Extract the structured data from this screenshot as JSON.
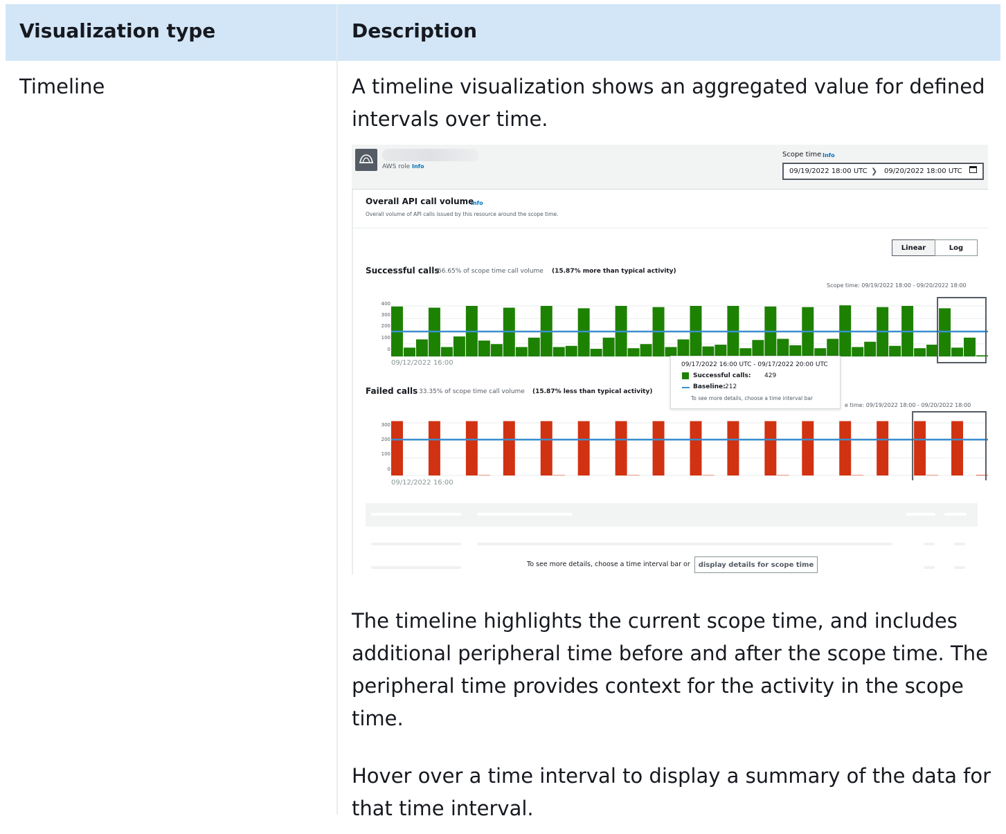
{
  "table": {
    "headers": [
      "Visualization type",
      "Description"
    ],
    "row": {
      "type": "Timeline",
      "description_intro": [
        "A timeline visualization shows an aggregated value for defined",
        "intervals over time."
      ],
      "description_p2": [
        "The timeline highlights the current scope time, and includes",
        "additional peripheral time before and after the scope time. The",
        "peripheral time provides context for the activity in the scope",
        "time."
      ],
      "description_p3": [
        "Hover over a time interval to display a summary of the data for",
        "that time interval."
      ]
    }
  },
  "screenshot": {
    "role_label": "AWS role",
    "info": "Info",
    "scope_time_label": "Scope time",
    "scope_start": "09/19/2022 18:00 UTC",
    "scope_end": "09/20/2022 18:00 UTC",
    "panel_title": "Overall API call volume",
    "panel_subtitle": "Overall volume of API calls issued by this resource around the scope time.",
    "scale_options": [
      "Linear",
      "Log"
    ],
    "scope_range": "Scope time: 09/19/2022 18:00 - 09/20/2022 18:00",
    "scope_range_partial": "e time: 09/19/2022 18:00 - 09/20/2022 18:00",
    "details_prompt": "To see more details, choose a time interval bar or",
    "details_button": "display details for scope time",
    "tooltip": {
      "range": "09/17/2022 16:00 UTC - 09/17/2022 20:00 UTC",
      "successful": "Successful calls:",
      "successful_value": "429",
      "baseline": "Baseline:",
      "baseline_value": "212",
      "hint": "To see more details, choose a time interval bar"
    },
    "colors": {
      "success": "#1d8102",
      "failed": "#d13212",
      "baseline": "#3b8fd0",
      "header": "#d3e6f8"
    }
  },
  "chart_data": [
    {
      "type": "bar",
      "title": "Successful calls",
      "subtitle": "66.65% of scope time call volume",
      "subtitle_emphasis": "(15.87% more than typical activity)",
      "x_start_label": "09/12/2022 16:00",
      "y_ticks": [
        "400",
        "300",
        "200",
        "100",
        "0"
      ],
      "ylim": [
        0,
        430
      ],
      "baseline": 212,
      "values": [
        425,
        75,
        145,
        415,
        80,
        170,
        430,
        135,
        105,
        415,
        80,
        160,
        430,
        80,
        90,
        410,
        65,
        160,
        430,
        70,
        105,
        420,
        80,
        145,
        430,
        85,
        100,
        430,
        70,
        140,
        425,
        150,
        95,
        420,
        70,
        150,
        435,
        80,
        125,
        420,
        90,
        430,
        70,
        100,
        410,
        75,
        160,
        10
      ],
      "scope_range_bars": [
        44,
        47
      ]
    },
    {
      "type": "bar",
      "title": "Failed calls",
      "subtitle": "33.35% of scope time call volume",
      "subtitle_emphasis": "(15.87% less than typical activity)",
      "x_start_label": "09/12/2022 16:00",
      "y_ticks": [
        "300",
        "200",
        "100",
        "0"
      ],
      "ylim": [
        0,
        300
      ],
      "baseline": 205,
      "values": [
        310,
        0,
        0,
        310,
        0,
        0,
        310,
        2,
        0,
        310,
        0,
        0,
        310,
        2,
        0,
        310,
        0,
        0,
        310,
        2,
        0,
        310,
        0,
        0,
        310,
        2,
        0,
        310,
        0,
        0,
        310,
        2,
        0,
        310,
        0,
        0,
        310,
        2,
        0,
        310,
        0,
        0,
        310,
        2,
        0,
        310,
        0,
        3
      ],
      "scope_range_bars": [
        42,
        47
      ]
    }
  ]
}
